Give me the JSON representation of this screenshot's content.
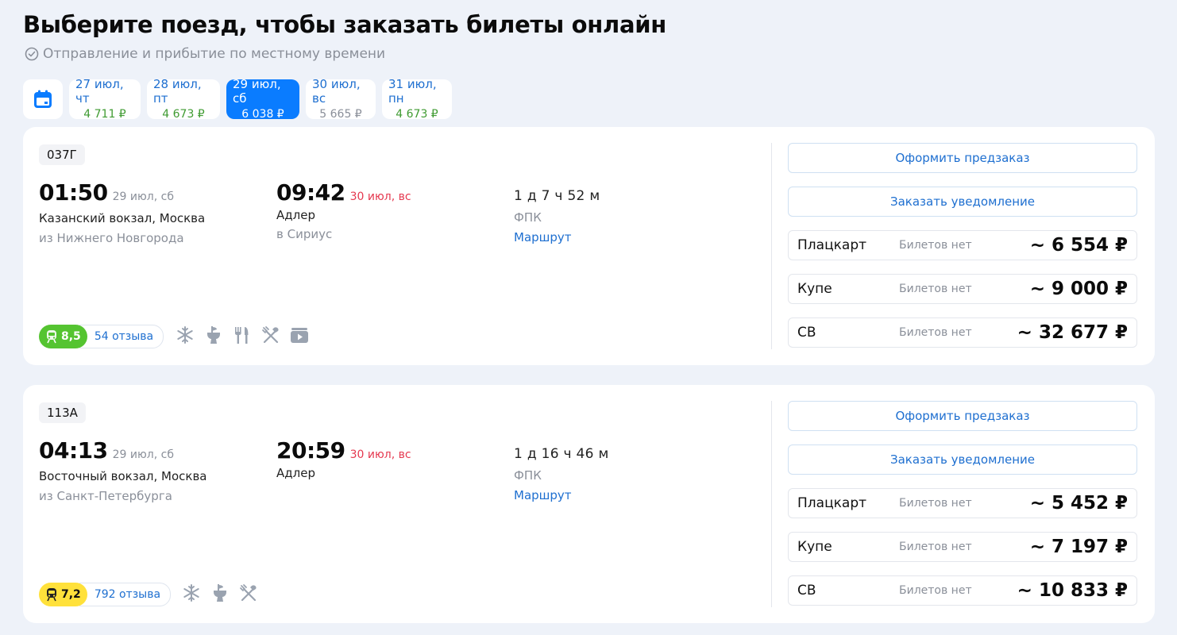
{
  "header": {
    "title": "Выберите поезд, чтобы заказать билеты онлайн",
    "subtitle": "Отправление и прибытие по местному времени"
  },
  "dates": [
    {
      "label": "27 июл, чт",
      "price": "4 711 ₽",
      "state": "available"
    },
    {
      "label": "28 июл, пт",
      "price": "4 673 ₽",
      "state": "available"
    },
    {
      "label": "29 июл, сб",
      "price": "6 038 ₽",
      "state": "selected"
    },
    {
      "label": "30 июл, вс",
      "price": "5 665 ₽",
      "state": "muted"
    },
    {
      "label": "31 июл, пн",
      "price": "4 673 ₽",
      "state": "available"
    }
  ],
  "trains": [
    {
      "number": "037Г",
      "departure": {
        "time": "01:50",
        "date": "29 июл, сб",
        "station": "Казанский вокзал, Москва",
        "note": "из Нижнего Новгорода"
      },
      "arrival": {
        "time": "09:42",
        "date": "30 июл, вс",
        "station": "Адлер",
        "note": "в Сириус"
      },
      "duration": "1 д 7 ч 52 м",
      "carrier": "ФПК",
      "route_label": "Маршрут",
      "rating": {
        "score": "8,5",
        "reviews": "54 отзыва",
        "color": "#55c431"
      },
      "amenities": [
        "snowflake-icon",
        "toilet-icon",
        "dining-icon",
        "food-icon",
        "video-icon"
      ],
      "buttons": {
        "preorder": "Оформить предзаказ",
        "notify": "Заказать уведомление"
      },
      "fares": [
        {
          "class": "Плацкарт",
          "availability": "Билетов нет",
          "price": "~ 6 554 ₽"
        },
        {
          "class": "Купе",
          "availability": "Билетов нет",
          "price": "~ 9 000 ₽"
        },
        {
          "class": "СВ",
          "availability": "Билетов нет",
          "price": "~ 32 677 ₽"
        }
      ]
    },
    {
      "number": "113А",
      "departure": {
        "time": "04:13",
        "date": "29 июл, сб",
        "station": "Восточный вокзал, Москва",
        "note": "из Санкт-Петербурга"
      },
      "arrival": {
        "time": "20:59",
        "date": "30 июл, вс",
        "station": "Адлер",
        "note": ""
      },
      "duration": "1 д 16 ч 46 м",
      "carrier": "ФПК",
      "route_label": "Маршрут",
      "rating": {
        "score": "7,2",
        "reviews": "792 отзыва",
        "color": "#ffe13b"
      },
      "amenities": [
        "snowflake-icon",
        "toilet-icon",
        "food-icon"
      ],
      "buttons": {
        "preorder": "Оформить предзаказ",
        "notify": "Заказать уведомление"
      },
      "fares": [
        {
          "class": "Плацкарт",
          "availability": "Билетов нет",
          "price": "~ 5 452 ₽"
        },
        {
          "class": "Купе",
          "availability": "Билетов нет",
          "price": "~ 7 197 ₽"
        },
        {
          "class": "СВ",
          "availability": "Билетов нет",
          "price": "~ 10 833 ₽"
        }
      ]
    }
  ]
}
